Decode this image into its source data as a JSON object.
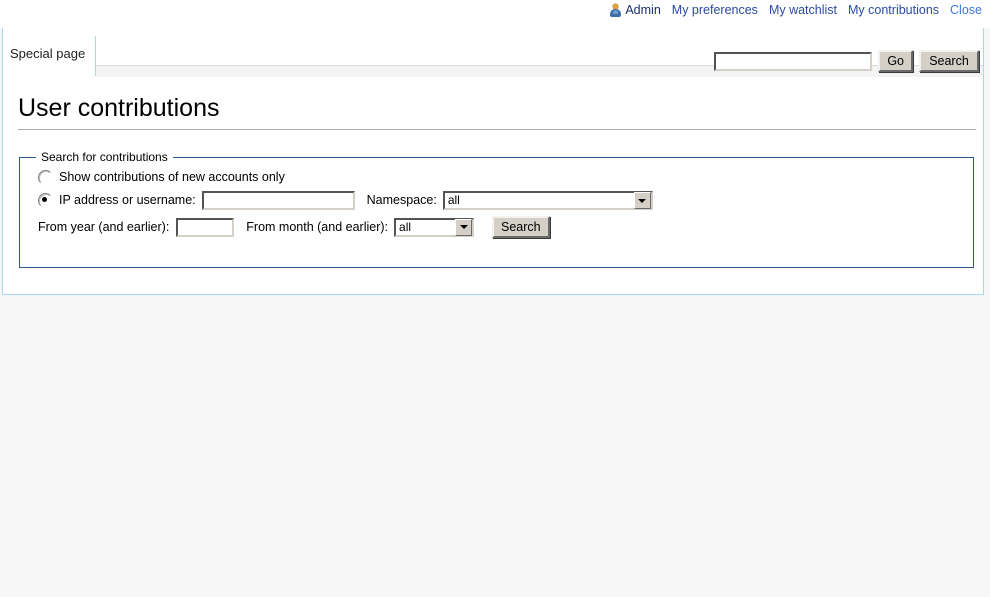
{
  "personal_bar": {
    "avatar_icon": "user-icon",
    "username": "Admin",
    "links": [
      {
        "label": "My preferences"
      },
      {
        "label": "My watchlist"
      },
      {
        "label": "My contributions"
      }
    ],
    "close_label": "Close"
  },
  "tabs": [
    {
      "label": "Special page"
    }
  ],
  "header_search": {
    "value": "",
    "placeholder": "",
    "go_label": "Go",
    "search_label": "Search"
  },
  "page": {
    "title": "User contributions"
  },
  "contributions_form": {
    "legend": "Search for contributions",
    "new_accounts_option": {
      "label": "Show contributions of new accounts only",
      "checked": false
    },
    "user_option": {
      "label": "IP address or username:",
      "checked": true,
      "value": "",
      "placeholder": ""
    },
    "namespace": {
      "label": "Namespace:",
      "value": "all",
      "options": [
        "all"
      ]
    },
    "from_year": {
      "label": "From year (and earlier):",
      "value": "",
      "placeholder": ""
    },
    "from_month": {
      "label": "From month (and earlier):",
      "value": "all",
      "options": [
        "all"
      ]
    },
    "submit_label": "Search"
  },
  "colors": {
    "accent_link": "#2b4aa0",
    "close_link": "#3c78d8",
    "frame_border": "#a7d7f9",
    "fieldset_border": "#2d5a8c",
    "page_background": "#f6f6f6"
  }
}
